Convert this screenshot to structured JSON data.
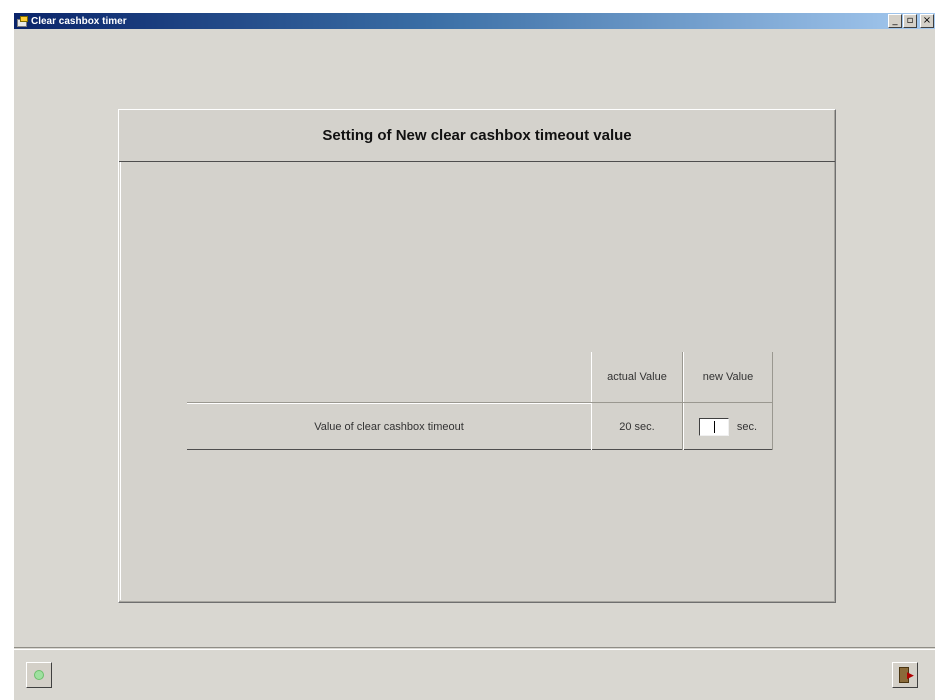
{
  "window": {
    "title": "Clear cashbox timer",
    "controls": {
      "minimize": "_",
      "restore": "▫",
      "close": "×"
    }
  },
  "panel": {
    "title": "Setting of New clear cashbox timeout value"
  },
  "table": {
    "headers": {
      "actual": "actual Value",
      "new": "new Value"
    },
    "row": {
      "label": "Value of clear cashbox timeout",
      "actual_value": "20 sec.",
      "new_value": "",
      "new_unit": "sec."
    }
  },
  "statusbar": {
    "left_button_icon": "green-led-icon",
    "right_button_icon": "exit-door-icon"
  },
  "colors": {
    "titlebar_start": "#0a246a",
    "titlebar_end": "#a6caf0",
    "background": "#d9d7d1"
  }
}
